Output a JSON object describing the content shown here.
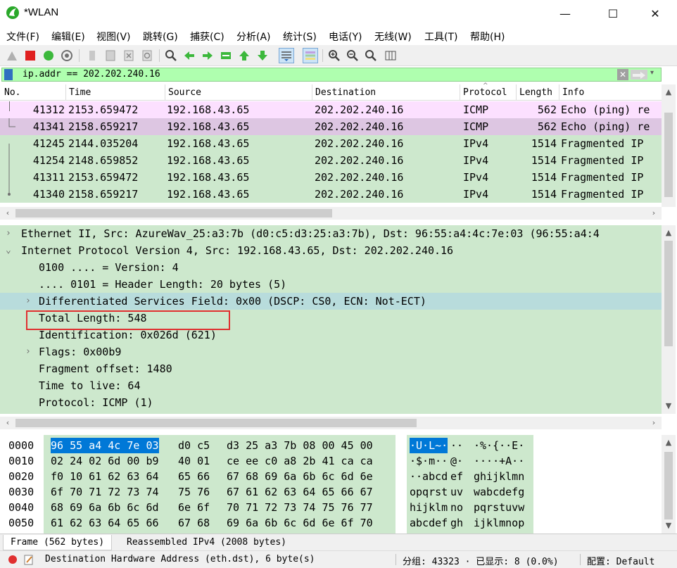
{
  "window": {
    "title": "*WLAN",
    "minimize": "—",
    "maximize": "☐",
    "close": "✕"
  },
  "menu": [
    "文件(F)",
    "编辑(E)",
    "视图(V)",
    "跳转(G)",
    "捕获(C)",
    "分析(A)",
    "统计(S)",
    "电话(Y)",
    "无线(W)",
    "工具(T)",
    "帮助(H)"
  ],
  "filter": {
    "value": "ip.addr == 202.202.240.16"
  },
  "packet_list": {
    "columns": [
      "No.",
      "Time",
      "Source",
      "Destination",
      "Protocol",
      "Length",
      "Info"
    ],
    "rows": [
      {
        "no": "41312",
        "time": "2153.659472",
        "src": "192.168.43.65",
        "dst": "202.202.240.16",
        "proto": "ICMP",
        "len": "562",
        "info": "Echo (ping) re",
        "bg": "#fce0ff"
      },
      {
        "no": "41341",
        "time": "2158.659217",
        "src": "192.168.43.65",
        "dst": "202.202.240.16",
        "proto": "ICMP",
        "len": "562",
        "info": "Echo (ping) re",
        "bg": "#ddc6e2"
      },
      {
        "no": "41245",
        "time": "2144.035204",
        "src": "192.168.43.65",
        "dst": "202.202.240.16",
        "proto": "IPv4",
        "len": "1514",
        "info": "Fragmented IP",
        "bg": "#cde8cd"
      },
      {
        "no": "41254",
        "time": "2148.659852",
        "src": "192.168.43.65",
        "dst": "202.202.240.16",
        "proto": "IPv4",
        "len": "1514",
        "info": "Fragmented IP",
        "bg": "#cde8cd"
      },
      {
        "no": "41311",
        "time": "2153.659472",
        "src": "192.168.43.65",
        "dst": "202.202.240.16",
        "proto": "IPv4",
        "len": "1514",
        "info": "Fragmented IP",
        "bg": "#cde8cd"
      },
      {
        "no": "41340",
        "time": "2158.659217",
        "src": "192.168.43.65",
        "dst": "202.202.240.16",
        "proto": "IPv4",
        "len": "1514",
        "info": "Fragmented IP",
        "bg": "#cde8cd"
      }
    ]
  },
  "details": [
    {
      "arrow": ">",
      "text": "Ethernet II, Src: AzureWav_25:a3:7b (d0:c5:d3:25:a3:7b), Dst: 96:55:a4:4c:7e:03 (96:55:a4:4",
      "indent": 0
    },
    {
      "arrow": "v",
      "text": "Internet Protocol Version 4, Src: 192.168.43.65, Dst: 202.202.240.16",
      "indent": 0
    },
    {
      "arrow": "",
      "text": "0100 .... = Version: 4",
      "indent": 1
    },
    {
      "arrow": "",
      "text": ".... 0101 = Header Length: 20 bytes (5)",
      "indent": 1
    },
    {
      "arrow": ">",
      "text": "Differentiated Services Field: 0x00 (DSCP: CS0, ECN: Not-ECT)",
      "indent": 1,
      "highlight": true
    },
    {
      "arrow": "",
      "text": "Total Length: 548",
      "indent": 1,
      "boxed": true
    },
    {
      "arrow": "",
      "text": "Identification: 0x026d (621)",
      "indent": 1
    },
    {
      "arrow": ">",
      "text": "Flags: 0x00b9",
      "indent": 1
    },
    {
      "arrow": "",
      "text": "Fragment offset: 1480",
      "indent": 1
    },
    {
      "arrow": "",
      "text": "Time to live: 64",
      "indent": 1
    },
    {
      "arrow": "",
      "text": "Protocol: ICMP (1)",
      "indent": 1
    }
  ],
  "bytes": [
    {
      "off": "0000",
      "hex1": "96 55 a4 4c 7e 03",
      "hex1b": "d0 c5",
      "hex2": "d3 25 a3 7b 08 00 45 00",
      "asc1": "·U·L~·",
      "asc1b": "··",
      "asc2": "·%·{··E·"
    },
    {
      "off": "0010",
      "hex1": "02 24 02 6d 00 b9",
      "hex1b": "40 01",
      "hex2": "ce ee c0 a8 2b 41 ca ca",
      "asc1": "·$·m··",
      "asc1b": "@·",
      "asc2": "····+A··"
    },
    {
      "off": "0020",
      "hex1": "f0 10 61 62 63 64",
      "hex1b": "65 66",
      "hex2": "67 68 69 6a 6b 6c 6d 6e",
      "asc1": "··abcd",
      "asc1b": "ef",
      "asc2": "ghijklmn"
    },
    {
      "off": "0030",
      "hex1": "6f 70 71 72 73 74",
      "hex1b": "75 76",
      "hex2": "67 61 62 63 64 65 66 67",
      "asc1": "opqrst",
      "asc1b": "uv",
      "asc2": "wabcdefg"
    },
    {
      "off": "0040",
      "hex1": "68 69 6a 6b 6c 6d",
      "hex1b": "6e 6f",
      "hex2": "70 71 72 73 74 75 76 77",
      "asc1": "hijklm",
      "asc1b": "no",
      "asc2": "pqrstuvw"
    },
    {
      "off": "0050",
      "hex1": "61 62 63 64 65 66",
      "hex1b": "67 68",
      "hex2": "69 6a 6b 6c 6d 6e 6f 70",
      "asc1": "abcdef",
      "asc1b": "gh",
      "asc2": "ijklmnop"
    }
  ],
  "tabs": [
    "Frame (562 bytes)",
    "Reassembled IPv4 (2008 bytes)"
  ],
  "status": {
    "field": "Destination Hardware Address (eth.dst), 6 byte(s)",
    "packets": "分组: 43323 · 已显示: 8 (0.0%)",
    "profile": "配置: Default"
  },
  "colors": {
    "selection": "#0078d7",
    "highlight_box": "#e03030",
    "green_row": "#cde8cd",
    "filter_bg": "#afffaf"
  }
}
